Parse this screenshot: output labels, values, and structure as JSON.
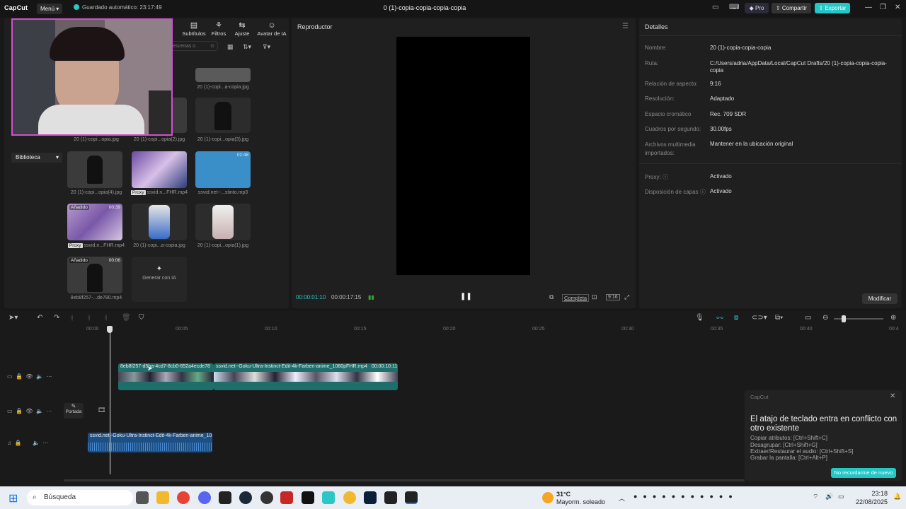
{
  "titlebar": {
    "app": "CapCut",
    "menu": "Menú",
    "autosave": "Guardado automático: 23:17:49",
    "project": "0 (1)-copia-copia-copia-copia",
    "pro": "Pro",
    "share": "Compartir",
    "export": "Exportar"
  },
  "media": {
    "tabs": [
      "Subtítulos",
      "Filtros",
      "Ajuste",
      "Avatar de IA"
    ],
    "search_placeholder": "os, escenas o",
    "library": "Biblioteca",
    "items": [
      {
        "label": "20 (1)-copi...a-copia.jpg"
      },
      {
        "label": "20 (1)-copi...opia.jpg"
      },
      {
        "label": "20 (1)-copi...opia(2).jpg"
      },
      {
        "label": "20 (1)-copi...opia(3).jpg"
      },
      {
        "label": "20 (1)-copi...opia(4).jpg"
      },
      {
        "label": "ssvid.n...FHR.mp4",
        "proxy": "Proxy"
      },
      {
        "label": "ssvid.net--...stinto.mp3",
        "duration": "02:48"
      },
      {
        "label": "ssvid.n...FHR.mp4",
        "proxy": "Proxy",
        "added": "Añadido",
        "duration": "00:39"
      },
      {
        "label": "20 (1)-copi...a-copia.jpg"
      },
      {
        "label": "20 (1)-copi...opia(1).jpg"
      },
      {
        "label": "8eb8f257-...de780.mp4",
        "added": "Añadido",
        "duration": "00:06"
      }
    ],
    "generate": "Generar con IA"
  },
  "player": {
    "title": "Reproductor",
    "current": "00:00:01:10",
    "total": "00:00:17:15",
    "complete": "Completa",
    "ratio": "9:16"
  },
  "details": {
    "title": "Detalles",
    "rows": [
      {
        "k": "Nombre:",
        "v": "20 (1)-copia-copia-copia"
      },
      {
        "k": "Ruta:",
        "v": "C:/Users/adria/AppData/Local/CapCut Drafts/20 (1)-copia-copia-copia-copia"
      },
      {
        "k": "Relación de aspecto:",
        "v": "9:16"
      },
      {
        "k": "Resolución:",
        "v": "Adaptado"
      },
      {
        "k": "Espacio cromático",
        "v": "Rec. 709 SDR"
      },
      {
        "k": "Cuadros por segundo:",
        "v": "30.00fps"
      },
      {
        "k": "Archivos multimedia importados:",
        "v": "Mantener en la ubicación original"
      },
      {
        "k": "Proxy:",
        "v": "Activado"
      },
      {
        "k": "Disposición de capas",
        "v": "Activado"
      }
    ],
    "modify": "Modificar"
  },
  "timeline": {
    "ticks": [
      "00:00",
      "00:05",
      "00:10",
      "00:15",
      "00:20",
      "00:25",
      "00:30",
      "00:35",
      "00:40",
      "00:4"
    ],
    "clip1": "8eb8f257-d5ba-4cd7-8cb0-652a4ecde78",
    "clip2": "ssvid.net--Goku-Ultra-Instinct-Edit-4k-Farben-anime_1080pFHR.mp4",
    "clip2_dur": "00:00:10:11",
    "audio": "ssvid.net--Goku-Ultra-Instinct-Edit-4k-Farben-anime_1080",
    "cover": "Portada"
  },
  "toast": {
    "brand": "CapCut",
    "title": "El atajo de teclado entra en conflicto con otro existente",
    "lines": [
      "Copiar atributos: [Ctrl+Shift+C]",
      "Desagrupar: [Ctrl+Shift+G]",
      "Extraer/Restaurar el audio: [Ctrl+Shift+S]",
      "Grabar la pantalla: [Ctrl+Alt+P]"
    ],
    "button": "No recordarme de nuevo"
  },
  "taskbar": {
    "search": "Búsqueda",
    "weather_temp": "31°C",
    "weather_desc": "Mayorm. soleado",
    "time": "23:18",
    "date": "22/08/2025"
  }
}
